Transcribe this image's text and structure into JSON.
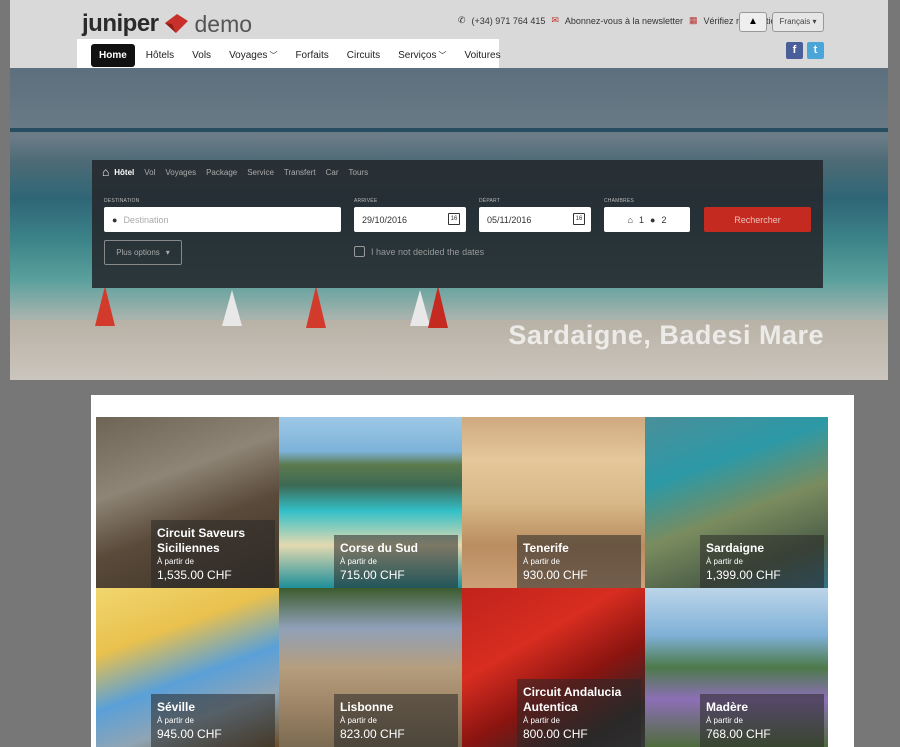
{
  "header": {
    "logo_word1": "juniper",
    "logo_word2": "demo",
    "phone": "(+34) 971 764 415",
    "newsletter": "Abonnez-vous à la newsletter",
    "booking": "Vérifiez réservation",
    "language": "Français",
    "social": [
      "facebook-icon",
      "twitter-icon"
    ]
  },
  "nav": {
    "items": [
      {
        "label": "Home",
        "active": true
      },
      {
        "label": "Hôtels"
      },
      {
        "label": "Vols"
      },
      {
        "label": "Voyages",
        "dropdown": true
      },
      {
        "label": "Forfaits"
      },
      {
        "label": "Circuits"
      },
      {
        "label": "Serviços",
        "dropdown": true
      },
      {
        "label": "Voitures"
      }
    ]
  },
  "search": {
    "tabs": [
      "Hôtel",
      "Vol",
      "Voyages",
      "Package",
      "Service",
      "Transfert",
      "Car",
      "Tours"
    ],
    "destination_label": "DESTINATION",
    "destination_placeholder": "Destination",
    "arrival_label": "ARRIVÉE",
    "arrival_value": "29/10/2016",
    "departure_label": "DÉPART",
    "departure_value": "05/11/2016",
    "rooms_label": "CHAMBRES",
    "rooms_count": "1",
    "guests_count": "2",
    "submit": "Rechercher",
    "more_options": "Plus options",
    "undecided_dates": "I have not decided the dates"
  },
  "hero": {
    "caption": "Sardaigne, Badesi Mare"
  },
  "destinations": [
    {
      "name": "Circuit Saveurs Siciliennes",
      "from": "À partir de",
      "price": "1,535.00 CHF"
    },
    {
      "name": "Corse du Sud",
      "from": "À partir de",
      "price": "715.00 CHF"
    },
    {
      "name": "Tenerife",
      "from": "À partir de",
      "price": "930.00 CHF"
    },
    {
      "name": "Sardaigne",
      "from": "À partir de",
      "price": "1,399.00 CHF"
    },
    {
      "name": "Séville",
      "from": "À partir de",
      "price": "945.00 CHF"
    },
    {
      "name": "Lisbonne",
      "from": "À partir de",
      "price": "823.00 CHF"
    },
    {
      "name": "Circuit Andalucia Autentica",
      "from": "À partir de",
      "price": "800.00 CHF"
    },
    {
      "name": "Madère",
      "from": "À partir de",
      "price": "768.00 CHF"
    }
  ],
  "colors": {
    "accent_red": "#c42a1f",
    "nav_active": "#111111",
    "facebook": "#4a5f9a",
    "twitter": "#4aa6d8"
  }
}
